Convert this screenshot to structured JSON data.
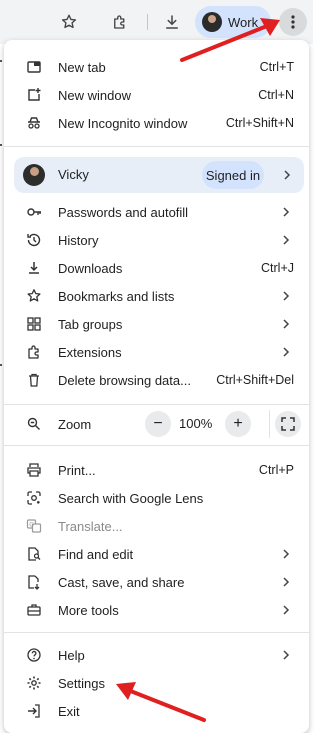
{
  "toolbar": {
    "profile_label": "Work",
    "icons": [
      "star-icon",
      "extensions-icon",
      "download-icon",
      "more-vert-icon"
    ]
  },
  "menu": {
    "new_tab": {
      "label": "New tab",
      "underline": "t",
      "prefix": "New ",
      "suffix": "ab",
      "shortcut": "Ctrl+T"
    },
    "new_window": {
      "label": "New window",
      "shortcut": "Ctrl+N"
    },
    "incognito": {
      "label": "New Incognito window",
      "shortcut": "Ctrl+Shift+N"
    },
    "profile": {
      "name": "Vicky",
      "status": "Signed in"
    },
    "passwords": {
      "label": "Passwords and autofill"
    },
    "history": {
      "label": "History"
    },
    "downloads": {
      "label": "Downloads",
      "shortcut": "Ctrl+J"
    },
    "bookmarks": {
      "label": "Bookmarks and lists"
    },
    "tab_groups": {
      "label": "Tab groups"
    },
    "extensions": {
      "label": "Extensions"
    },
    "delete_data": {
      "label": "Delete browsing data...",
      "shortcut": "Ctrl+Shift+Del"
    },
    "zoom": {
      "label": "Zoom",
      "value": "100%",
      "minus": "−",
      "plus": "+"
    },
    "print": {
      "label": "Print...",
      "shortcut": "Ctrl+P"
    },
    "lens": {
      "label": "Search with Google Lens"
    },
    "translate": {
      "label": "Translate..."
    },
    "find": {
      "label": "Find and edit"
    },
    "cast": {
      "label": "Cast, save, and share"
    },
    "more_tools": {
      "label": "More tools"
    },
    "help": {
      "label": "Help"
    },
    "settings": {
      "label": "Settings"
    },
    "exit": {
      "label": "Exit"
    }
  },
  "colors": {
    "accent_chip": "#d3e3fd",
    "profile_row": "#e8eef8",
    "annotation_arrow": "#e02020"
  }
}
